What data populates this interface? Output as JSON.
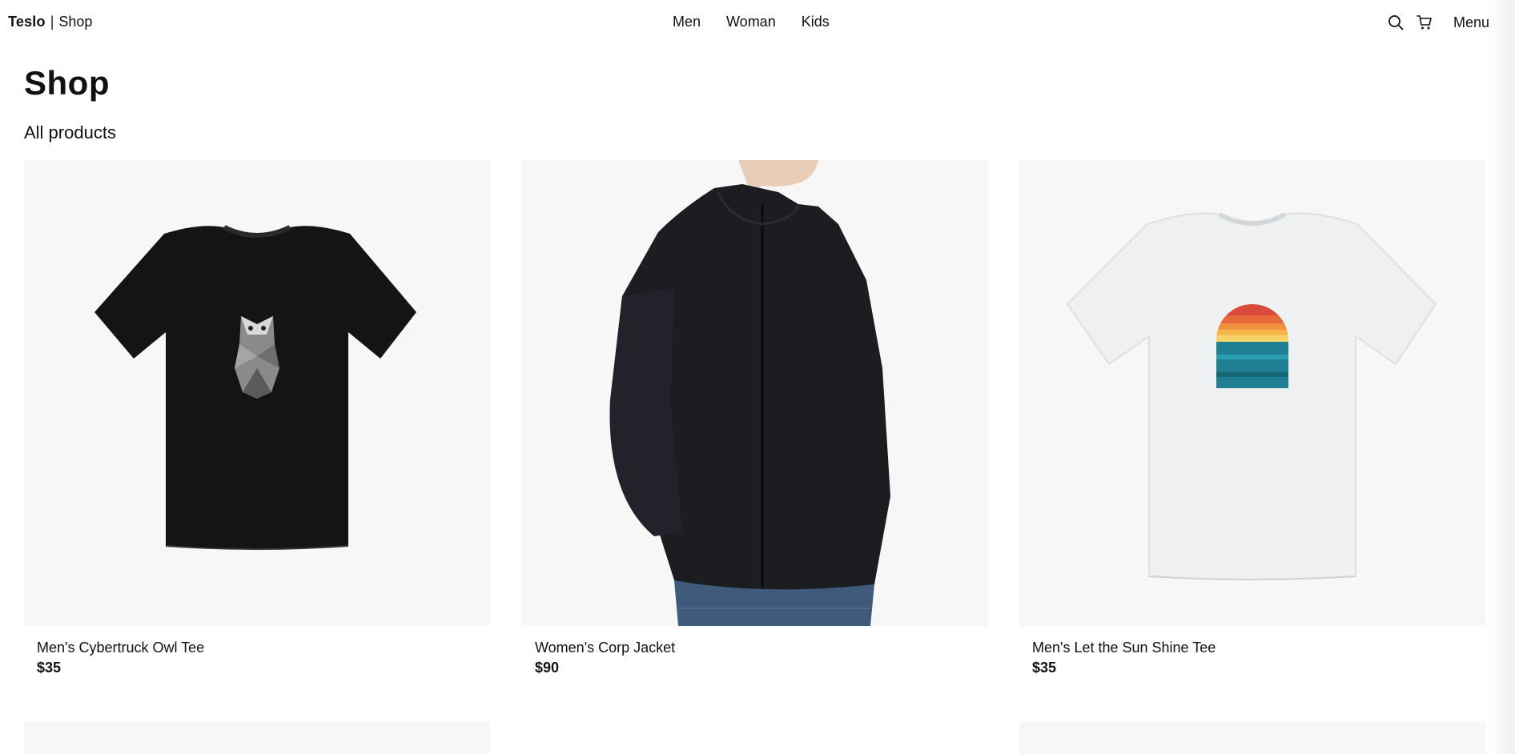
{
  "header": {
    "brand_name": "Teslo",
    "brand_separator": "|",
    "brand_sub": "Shop",
    "nav": [
      {
        "label": "Men"
      },
      {
        "label": "Woman"
      },
      {
        "label": "Kids"
      }
    ],
    "search_icon": "search-icon",
    "cart_icon": "cart-icon",
    "menu_label": "Menu"
  },
  "page": {
    "title": "Shop",
    "subtitle": "All products"
  },
  "products": [
    {
      "name": "Men's Cybertruck Owl Tee",
      "price": "$35",
      "image": "black-tshirt-owl-print"
    },
    {
      "name": "Women's Corp Jacket",
      "price": "$90",
      "image": "black-softshell-jacket-worn"
    },
    {
      "name": "Men's Let the Sun Shine Tee",
      "price": "$35",
      "image": "white-tshirt-sunset-print"
    }
  ],
  "colors": {
    "background": "#ffffff",
    "card_background": "#f7f7f7",
    "text": "#111111"
  }
}
